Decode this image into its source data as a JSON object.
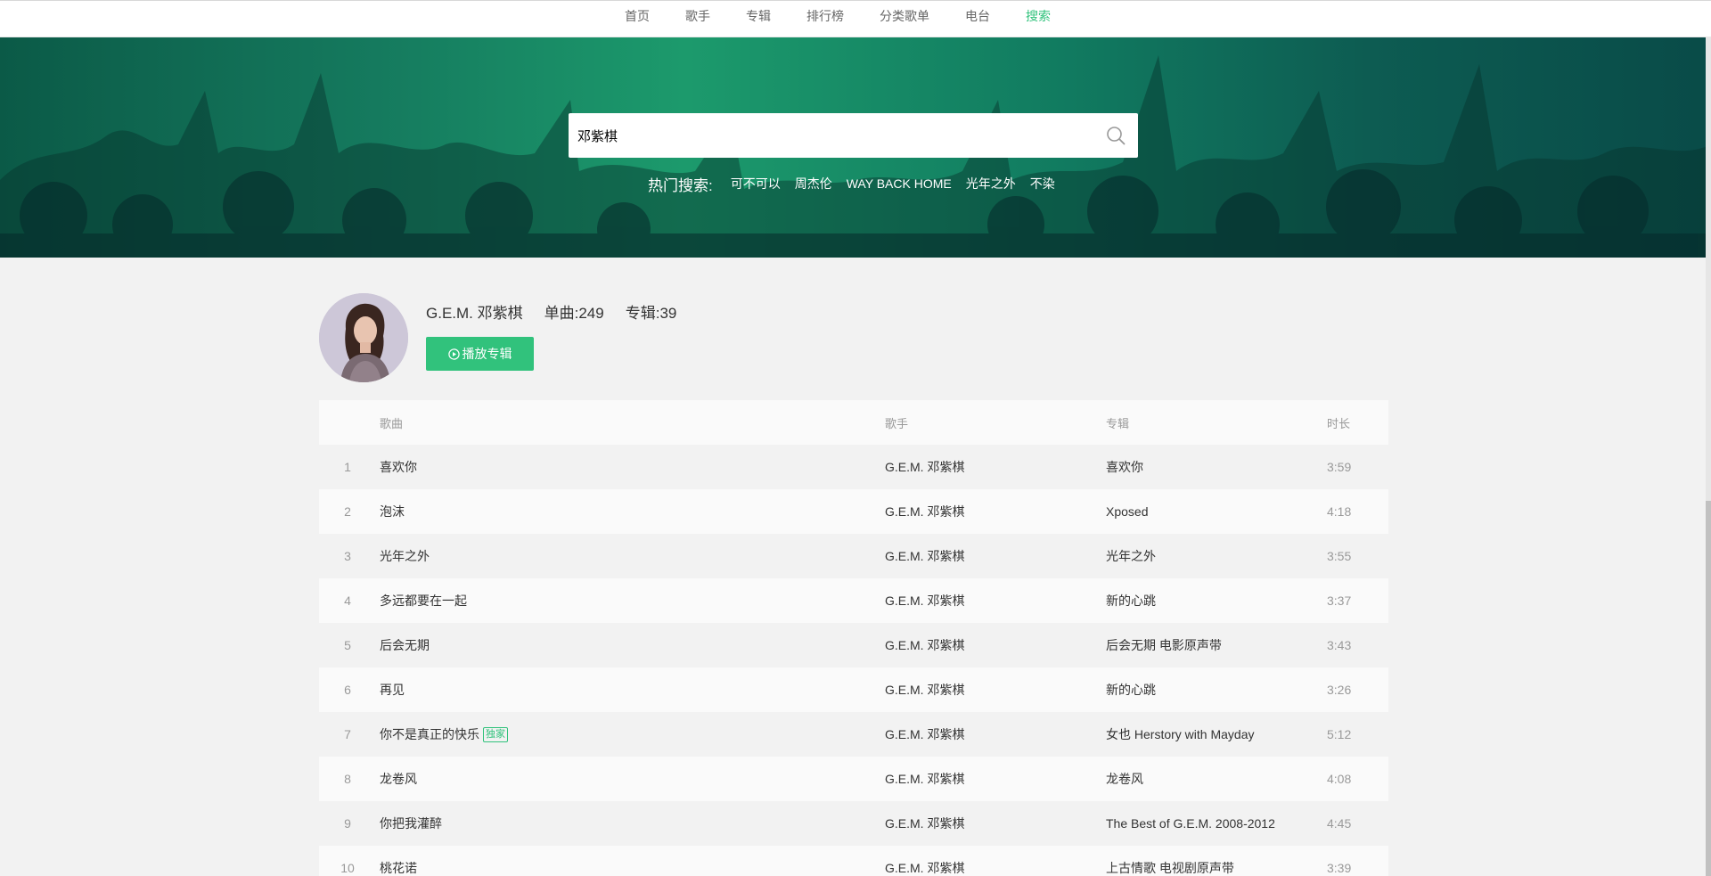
{
  "nav": {
    "items": [
      {
        "label": "首页"
      },
      {
        "label": "歌手"
      },
      {
        "label": "专辑"
      },
      {
        "label": "排行榜"
      },
      {
        "label": "分类歌单"
      },
      {
        "label": "电台"
      },
      {
        "label": "搜索"
      }
    ],
    "active": "搜索"
  },
  "search": {
    "value": "邓紫棋",
    "icon": "search-icon"
  },
  "hot": {
    "label": "热门搜索:",
    "items": [
      "可不可以",
      "周杰伦",
      "WAY BACK HOME",
      "光年之外",
      "不染"
    ]
  },
  "artist": {
    "name": "G.E.M. 邓紫棋",
    "singles": "单曲:249",
    "albums": "专辑:39",
    "play_label": "播放专辑",
    "play_icon": "play-circle-icon"
  },
  "table": {
    "headers": {
      "song": "歌曲",
      "singer": "歌手",
      "album": "专辑",
      "time": "时长"
    },
    "rows": [
      {
        "idx": "1",
        "song": "喜欢你",
        "tag": "",
        "singer": "G.E.M. 邓紫棋",
        "album": "喜欢你",
        "time": "3:59"
      },
      {
        "idx": "2",
        "song": "泡沫",
        "tag": "",
        "singer": "G.E.M. 邓紫棋",
        "album": "Xposed",
        "time": "4:18"
      },
      {
        "idx": "3",
        "song": "光年之外",
        "tag": "",
        "singer": "G.E.M. 邓紫棋",
        "album": "光年之外",
        "time": "3:55"
      },
      {
        "idx": "4",
        "song": "多远都要在一起",
        "tag": "",
        "singer": "G.E.M. 邓紫棋",
        "album": "新的心跳",
        "time": "3:37"
      },
      {
        "idx": "5",
        "song": "后会无期",
        "tag": "",
        "singer": "G.E.M. 邓紫棋",
        "album": "后会无期 电影原声带",
        "time": "3:43"
      },
      {
        "idx": "6",
        "song": "再见",
        "tag": "",
        "singer": "G.E.M. 邓紫棋",
        "album": "新的心跳",
        "time": "3:26"
      },
      {
        "idx": "7",
        "song": "你不是真正的快乐",
        "tag": "独家",
        "singer": "G.E.M. 邓紫棋",
        "album": "女也 Herstory with Mayday",
        "time": "5:12"
      },
      {
        "idx": "8",
        "song": "龙卷风",
        "tag": "",
        "singer": "G.E.M. 邓紫棋",
        "album": "龙卷风",
        "time": "4:08"
      },
      {
        "idx": "9",
        "song": "你把我灌醉",
        "tag": "",
        "singer": "G.E.M. 邓紫棋",
        "album": "The Best of G.E.M. 2008-2012",
        "time": "4:45"
      },
      {
        "idx": "10",
        "song": "桃花诺",
        "tag": "",
        "singer": "G.E.M. 邓紫棋",
        "album": "上古情歌 电视剧原声带",
        "time": "3:39"
      }
    ]
  },
  "colors": {
    "accent": "#31c27c",
    "banner_dark": "#0b5a47",
    "banner_light": "#1c9a6c"
  }
}
